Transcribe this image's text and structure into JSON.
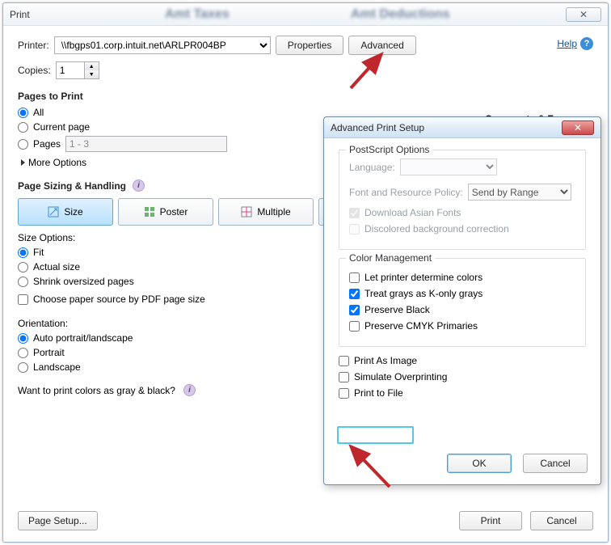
{
  "window": {
    "title": "Print",
    "blur1": "Amt Taxes",
    "blur2": "Amt Deductions",
    "close_glyph": "✕"
  },
  "help": {
    "label": "Help",
    "glyph": "?"
  },
  "printer": {
    "label": "Printer:",
    "value": "\\\\fbgps01.corp.intuit.net\\ARLPR004BP",
    "properties_btn": "Properties",
    "advanced_btn": "Advanced"
  },
  "copies": {
    "label": "Copies:",
    "value": "1"
  },
  "pages_to_print": {
    "heading": "Pages to Print",
    "all": "All",
    "current": "Current page",
    "pages": "Pages",
    "pages_value": "1 - 3",
    "more": "More Options"
  },
  "sizing": {
    "heading": "Page Sizing & Handling",
    "tabs": {
      "size": "Size",
      "poster": "Poster",
      "multiple": "Multiple"
    }
  },
  "size_options": {
    "heading": "Size Options:",
    "fit": "Fit",
    "actual": "Actual size",
    "shrink": "Shrink oversized pages",
    "choose_source": "Choose paper source by PDF page size"
  },
  "orientation": {
    "heading": "Orientation:",
    "auto": "Auto portrait/landscape",
    "portrait": "Portrait",
    "landscape": "Landscape"
  },
  "gray_question": "Want to print colors as gray & black?",
  "comments_forms": "Comments & Forms",
  "footer": {
    "page_setup": "Page Setup...",
    "print": "Print",
    "cancel": "Cancel"
  },
  "advanced_dialog": {
    "title": "Advanced Print Setup",
    "close_glyph": "✕",
    "postscript": {
      "legend": "PostScript Options",
      "language_label": "Language:",
      "policy_label": "Font and Resource Policy:",
      "policy_value": "Send by Range",
      "download_asian": "Download Asian Fonts",
      "discolored": "Discolored background correction"
    },
    "color_mgmt": {
      "legend": "Color Management",
      "let_printer": "Let printer determine colors",
      "treat_grays": "Treat grays as K-only grays",
      "preserve_black": "Preserve Black",
      "preserve_cmyk": "Preserve CMYK Primaries"
    },
    "print_as_image": "Print As Image",
    "simulate_overprint": "Simulate Overprinting",
    "print_to_file": "Print to File",
    "ok": "OK",
    "cancel": "Cancel"
  }
}
